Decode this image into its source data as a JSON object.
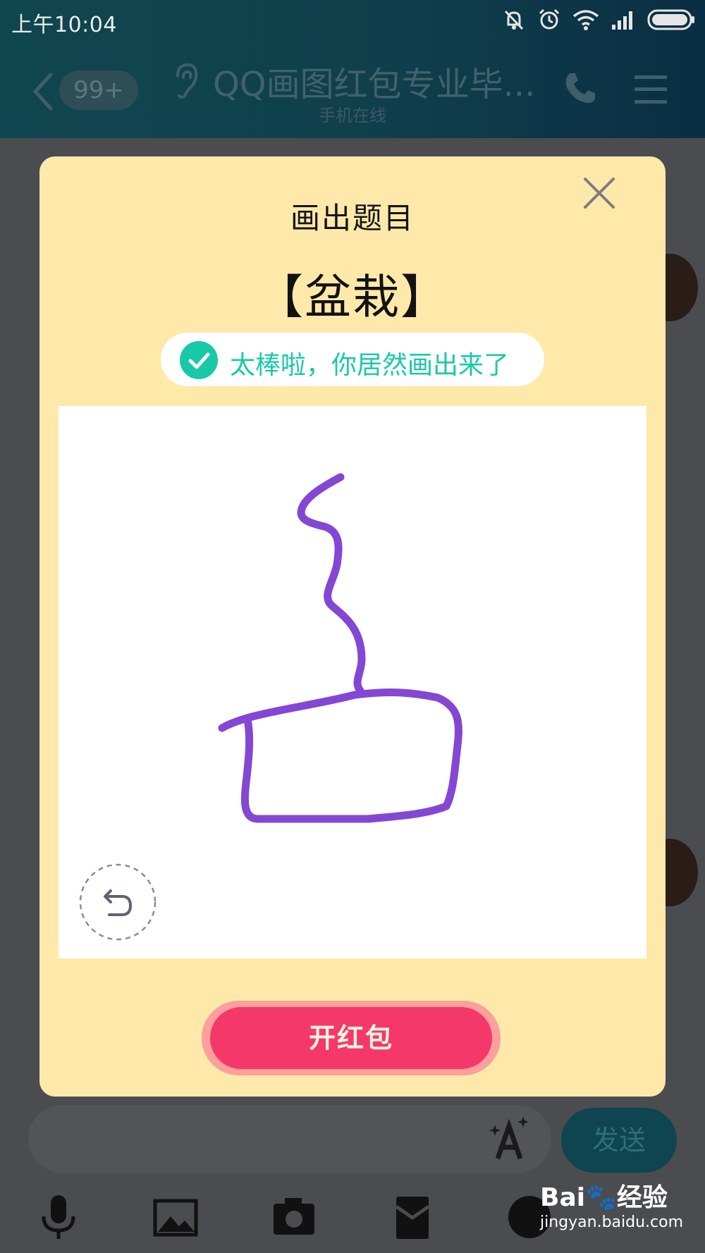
{
  "status_bar": {
    "time": "上午10:04",
    "icons": [
      "mute-icon",
      "alarm-icon",
      "wifi-icon",
      "signal-icon",
      "battery-icon"
    ]
  },
  "header": {
    "back_icon": "chevron-left-icon",
    "unread_badge": "99+",
    "ear_icon": "ear-icon",
    "title": "QQ画图红包专业毕...",
    "subtitle": "手机在线",
    "call_icon": "phone-icon",
    "menu_icon": "menu-icon"
  },
  "modal": {
    "heading": "画出题目",
    "word": "【盆栽】",
    "result_text": "太棒啦，你居然画出来了",
    "open_button": "开红包",
    "close_icon": "close-icon",
    "undo_icon": "undo-icon",
    "check_icon": "check-icon",
    "colors": {
      "background": "#fee9ab",
      "stroke": "#8347d4",
      "success": "#18c9a8",
      "button": "#f4396a"
    }
  },
  "input_bar": {
    "send_label": "发送",
    "font_icon": "font-style-icon"
  },
  "bottom_toolbar": {
    "icons": [
      "microphone-icon",
      "image-icon",
      "camera-icon",
      "red-packet-icon",
      "emoji-icon"
    ]
  },
  "watermark": {
    "logo": "Bai🐾经验",
    "url": "jingyan.baidu.com"
  }
}
